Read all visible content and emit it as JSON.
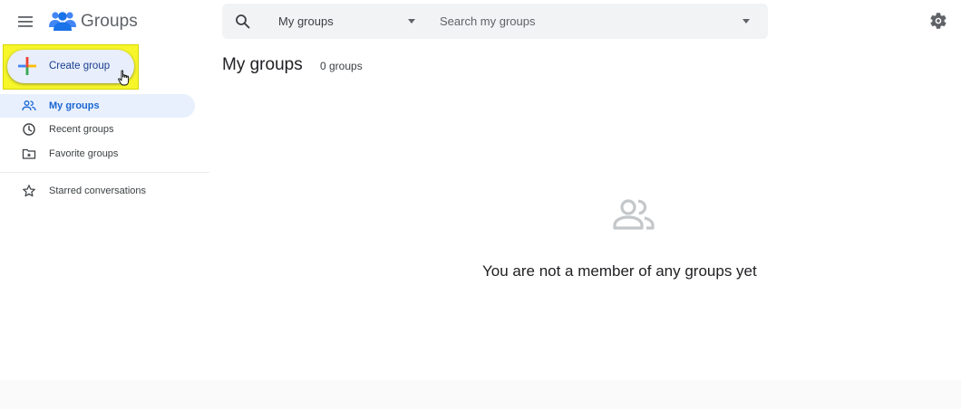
{
  "header": {
    "app_title": "Groups",
    "menu_icon": "hamburger-menu-icon",
    "logo_icon": "groups-people-icon",
    "settings_icon": "gear-icon"
  },
  "search": {
    "scope_value": "My groups",
    "placeholder": "Search my groups",
    "value": ""
  },
  "sidebar": {
    "create_label": "Create group",
    "items": [
      {
        "label": "My groups",
        "icon": "people-outline-icon",
        "active": true
      },
      {
        "label": "Recent groups",
        "icon": "clock-icon",
        "active": false
      },
      {
        "label": "Favorite groups",
        "icon": "folder-star-icon",
        "active": false
      },
      {
        "label": "Starred conversations",
        "icon": "star-outline-icon",
        "active": false
      }
    ]
  },
  "main": {
    "title": "My groups",
    "count": "0 groups",
    "empty_message": "You are not a member of any groups yet"
  },
  "colors": {
    "active_blue": "#1967d2",
    "active_bg": "#e8f0fe",
    "highlight_yellow": "#f6f62a",
    "search_bg": "#f1f3f4",
    "logo_blue": "#1a73e8"
  }
}
